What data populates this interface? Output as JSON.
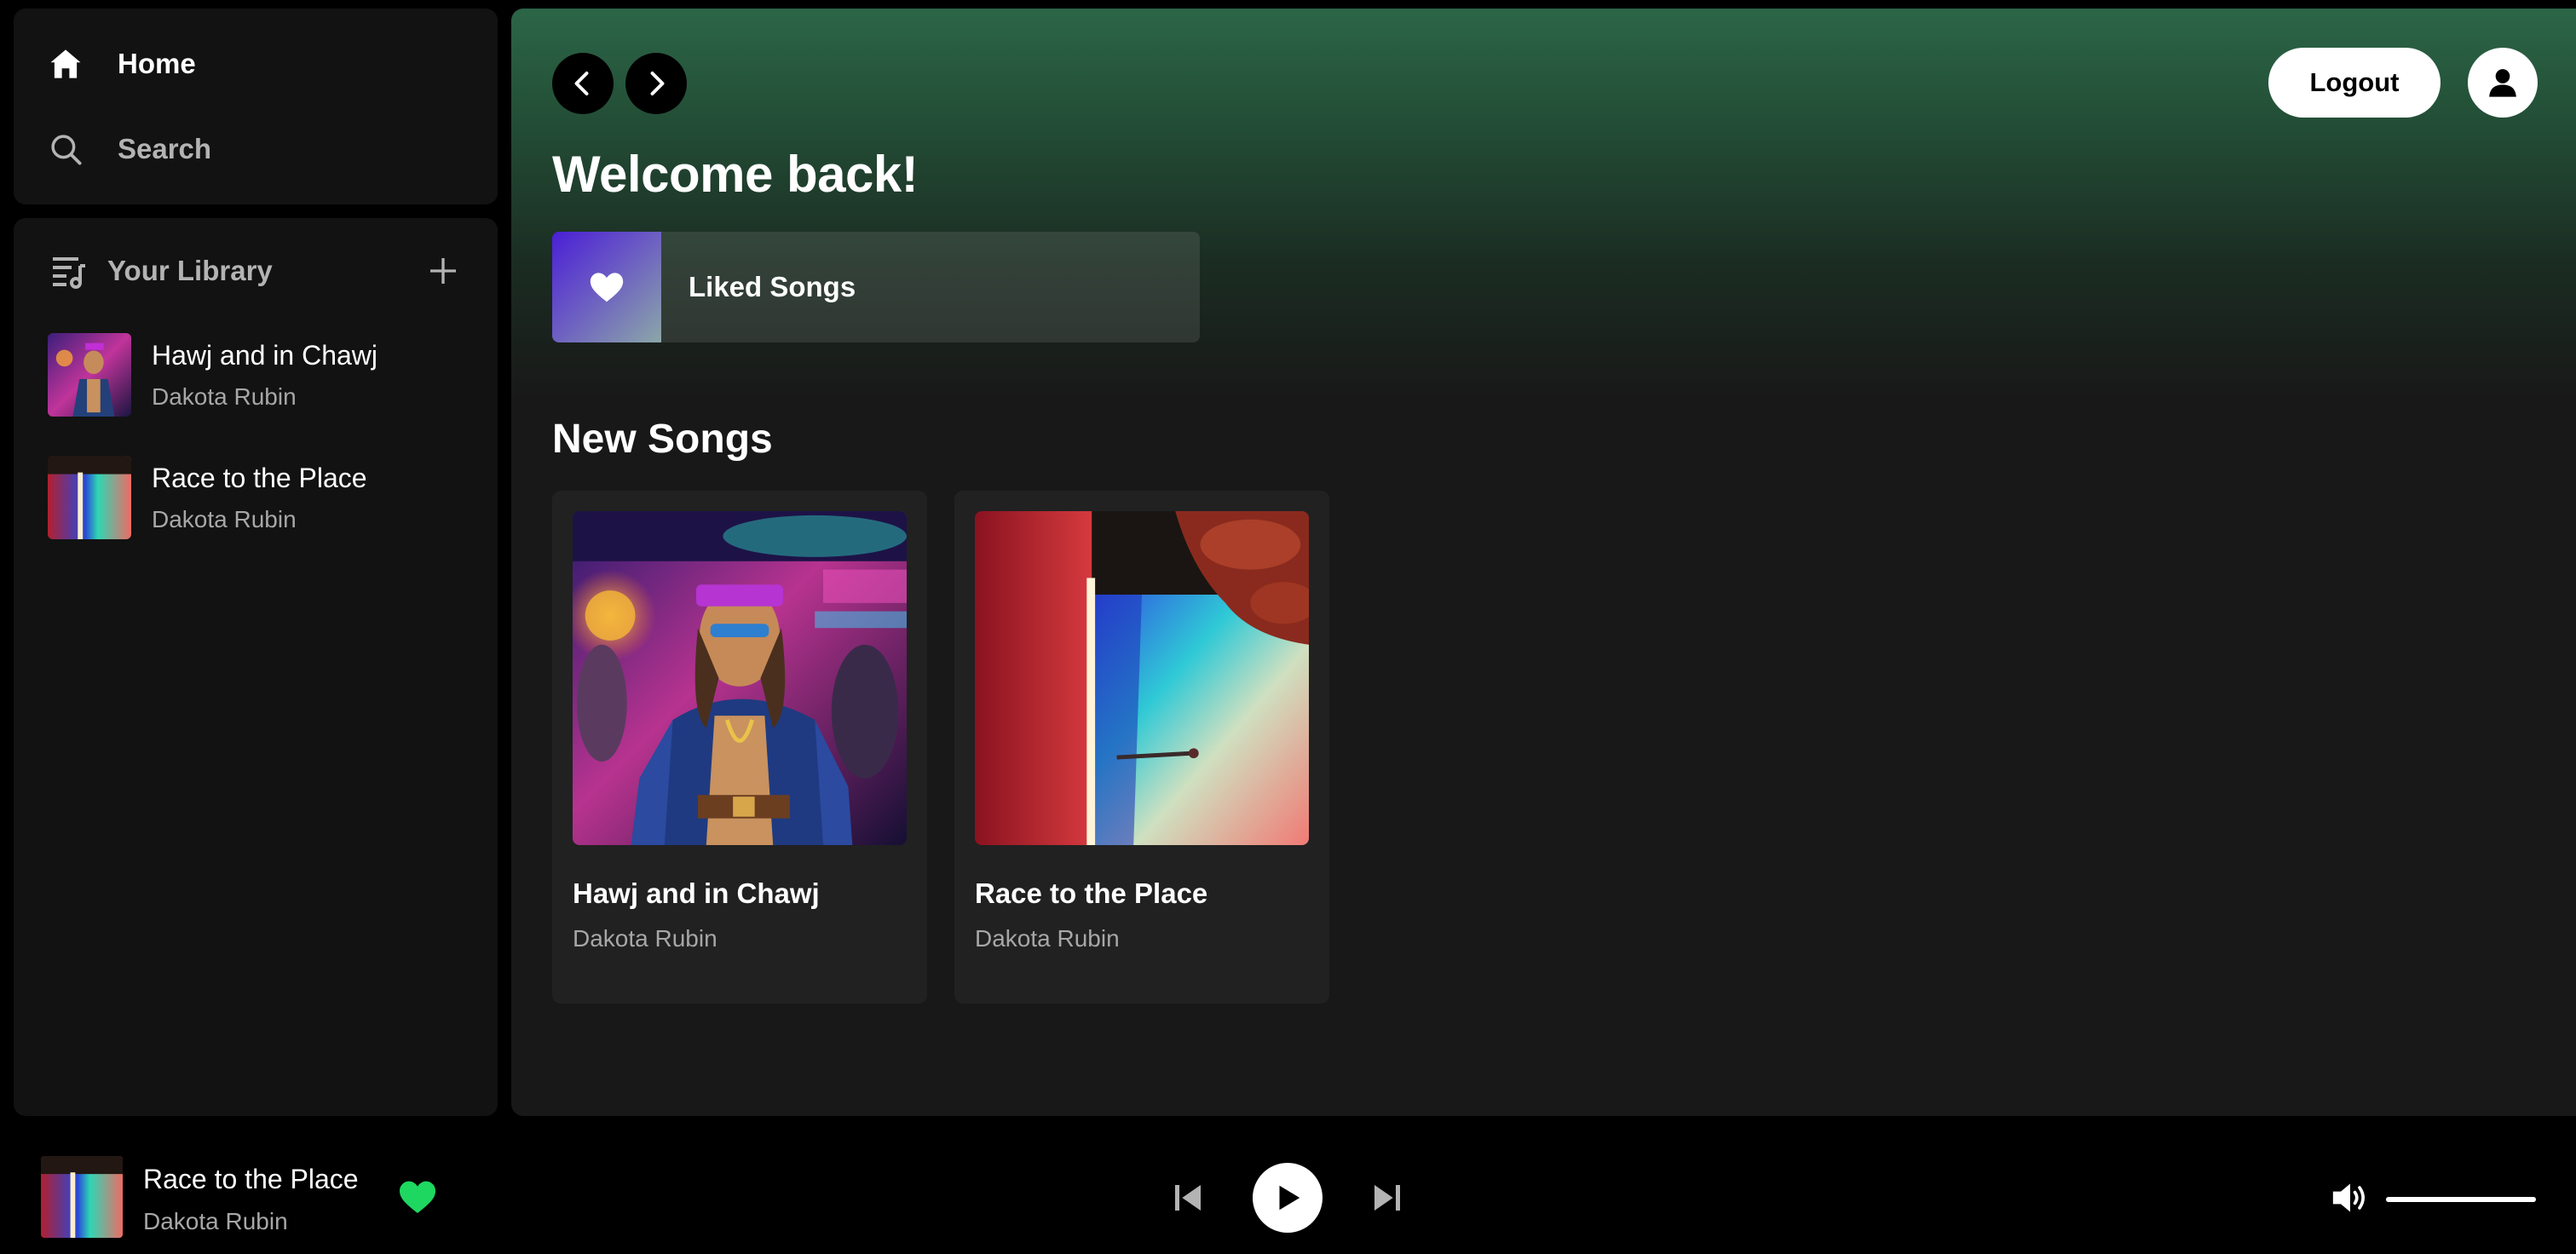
{
  "nav": {
    "home_label": "Home",
    "search_label": "Search"
  },
  "library": {
    "title": "Your Library",
    "items": [
      {
        "name": "Hawj and in Chawj",
        "artist": "Dakota Rubin"
      },
      {
        "name": "Race to the Place",
        "artist": "Dakota Rubin"
      }
    ]
  },
  "header": {
    "logout_label": "Logout"
  },
  "main": {
    "welcome": "Welcome back!",
    "liked_songs_label": "Liked Songs",
    "section_title": "New Songs",
    "songs": [
      {
        "title": "Hawj and in Chawj",
        "artist": "Dakota Rubin"
      },
      {
        "title": "Race to the Place",
        "artist": "Dakota Rubin"
      }
    ]
  },
  "player": {
    "now_playing_title": "Race to the Place",
    "now_playing_artist": "Dakota Rubin",
    "liked": true,
    "volume": 1.0
  },
  "colors": {
    "accent_green": "#1ed760",
    "header_gradient_top": "#2c6547",
    "background": "#000000",
    "panel": "#121212"
  },
  "icons": [
    "home-icon",
    "search-icon",
    "library-icon",
    "plus-icon",
    "chevron-left-icon",
    "chevron-right-icon",
    "user-icon",
    "heart-icon",
    "previous-icon",
    "play-icon",
    "next-icon",
    "volume-icon"
  ]
}
